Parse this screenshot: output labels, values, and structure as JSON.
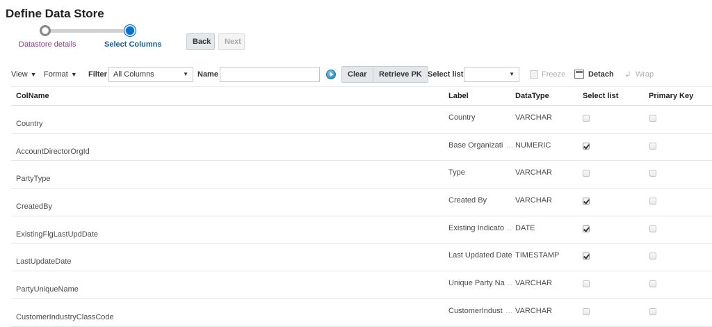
{
  "page": {
    "title": "Define Data Store"
  },
  "train": {
    "steps": [
      {
        "label": "Datastore details",
        "state": "visited"
      },
      {
        "label": "Select Columns",
        "state": "current"
      }
    ]
  },
  "nav": {
    "back_label": "Back",
    "next_label": "Next"
  },
  "toolbar": {
    "view_label": "View",
    "format_label": "Format",
    "filter_label": "Filter",
    "filter_value": "All Columns",
    "name_label": "Name",
    "name_value": "",
    "clear_label": "Clear",
    "retrieve_pk_label": "Retrieve PK",
    "select_list_label": "Select list",
    "select_list_value": "",
    "freeze_label": "Freeze",
    "detach_label": "Detach",
    "wrap_label": "Wrap"
  },
  "table": {
    "columns": [
      "ColName",
      "Label",
      "DataType",
      "Select list",
      "Primary Key"
    ],
    "rows": [
      {
        "colname": "Country",
        "label": "Country",
        "truncated": false,
        "datatype": "VARCHAR",
        "select_list": false,
        "primary_key": false
      },
      {
        "colname": "AccountDirectorOrgId",
        "label": "Base Organizati",
        "truncated": true,
        "datatype": "NUMERIC",
        "select_list": true,
        "primary_key": false
      },
      {
        "colname": "PartyType",
        "label": "Type",
        "truncated": false,
        "datatype": "VARCHAR",
        "select_list": false,
        "primary_key": false
      },
      {
        "colname": "CreatedBy",
        "label": "Created By",
        "truncated": false,
        "datatype": "VARCHAR",
        "select_list": true,
        "primary_key": false
      },
      {
        "colname": "ExistingFlgLastUpdDate",
        "label": "Existing Indicato",
        "truncated": true,
        "datatype": "DATE",
        "select_list": true,
        "primary_key": false
      },
      {
        "colname": "LastUpdateDate",
        "label": "Last Updated Date",
        "truncated": false,
        "datatype": "TIMESTAMP",
        "select_list": true,
        "primary_key": false
      },
      {
        "colname": "PartyUniqueName",
        "label": "Unique Party Na",
        "truncated": true,
        "datatype": "VARCHAR",
        "select_list": false,
        "primary_key": false
      },
      {
        "colname": "CustomerIndustryClassCode",
        "label": "CustomerIndust",
        "truncated": true,
        "datatype": "VARCHAR",
        "select_list": false,
        "primary_key": false
      }
    ]
  }
}
